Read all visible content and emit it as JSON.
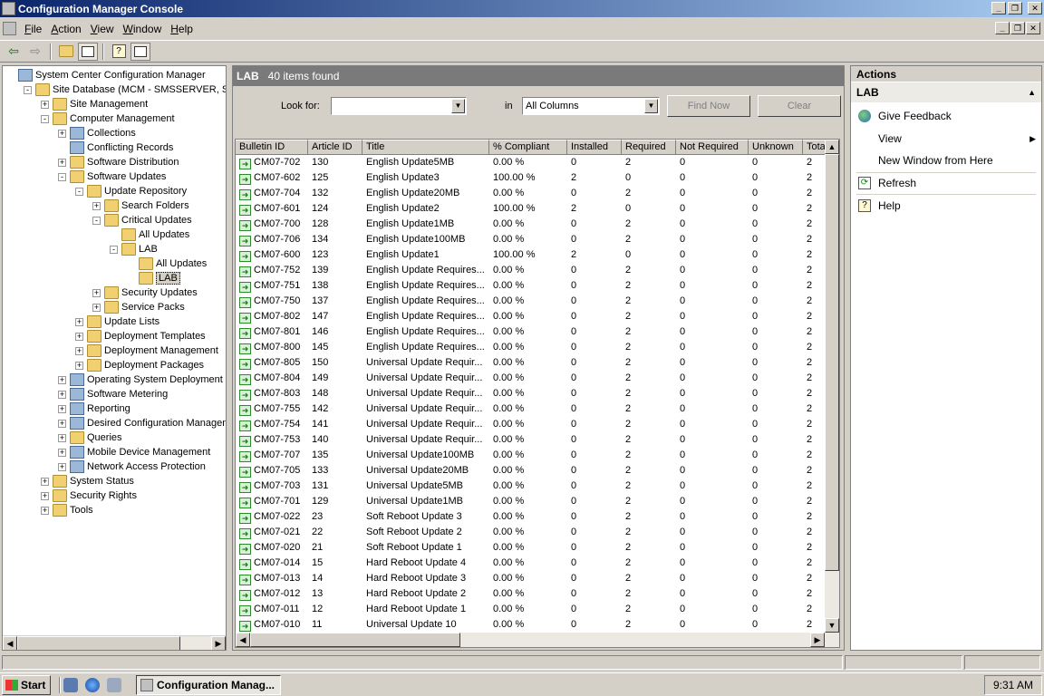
{
  "window": {
    "title": "Configuration Manager Console"
  },
  "menu": [
    "File",
    "Action",
    "View",
    "Window",
    "Help"
  ],
  "tree": [
    {
      "label": "System Center Configuration Manager",
      "level": 0,
      "exp": "none",
      "icon": "pc"
    },
    {
      "label": "Site Database  (MCM - SMSSERVER, SCCM",
      "level": 1,
      "exp": "-",
      "icon": "folder"
    },
    {
      "label": "Site Management",
      "level": 2,
      "exp": "+",
      "icon": "folder"
    },
    {
      "label": "Computer Management",
      "level": 2,
      "exp": "-",
      "icon": "folder"
    },
    {
      "label": "Collections",
      "level": 3,
      "exp": "+",
      "icon": "pc"
    },
    {
      "label": "Conflicting Records",
      "level": 3,
      "exp": "none",
      "icon": "pc"
    },
    {
      "label": "Software Distribution",
      "level": 3,
      "exp": "+",
      "icon": "folder"
    },
    {
      "label": "Software Updates",
      "level": 3,
      "exp": "-",
      "icon": "folder"
    },
    {
      "label": "Update Repository",
      "level": 4,
      "exp": "-",
      "icon": "folder"
    },
    {
      "label": "Search Folders",
      "level": 5,
      "exp": "+",
      "icon": "folder"
    },
    {
      "label": "Critical Updates",
      "level": 5,
      "exp": "-",
      "icon": "folder"
    },
    {
      "label": "All Updates",
      "level": 6,
      "exp": "none",
      "icon": "folder"
    },
    {
      "label": "LAB",
      "level": 6,
      "exp": "-",
      "icon": "folder"
    },
    {
      "label": "All Updates",
      "level": 7,
      "exp": "none",
      "icon": "folder"
    },
    {
      "label": "LAB",
      "level": 7,
      "exp": "none",
      "icon": "folder",
      "selected": true
    },
    {
      "label": "Security Updates",
      "level": 5,
      "exp": "+",
      "icon": "folder"
    },
    {
      "label": "Service Packs",
      "level": 5,
      "exp": "+",
      "icon": "folder"
    },
    {
      "label": "Update Lists",
      "level": 4,
      "exp": "+",
      "icon": "folder"
    },
    {
      "label": "Deployment Templates",
      "level": 4,
      "exp": "+",
      "icon": "folder"
    },
    {
      "label": "Deployment Management",
      "level": 4,
      "exp": "+",
      "icon": "folder"
    },
    {
      "label": "Deployment Packages",
      "level": 4,
      "exp": "+",
      "icon": "folder"
    },
    {
      "label": "Operating System Deployment",
      "level": 3,
      "exp": "+",
      "icon": "pc"
    },
    {
      "label": "Software Metering",
      "level": 3,
      "exp": "+",
      "icon": "pc"
    },
    {
      "label": "Reporting",
      "level": 3,
      "exp": "+",
      "icon": "pc"
    },
    {
      "label": "Desired Configuration Managemen",
      "level": 3,
      "exp": "+",
      "icon": "pc"
    },
    {
      "label": "Queries",
      "level": 3,
      "exp": "+",
      "icon": "folder"
    },
    {
      "label": "Mobile Device Management",
      "level": 3,
      "exp": "+",
      "icon": "pc"
    },
    {
      "label": "Network Access Protection",
      "level": 3,
      "exp": "+",
      "icon": "pc"
    },
    {
      "label": "System Status",
      "level": 2,
      "exp": "+",
      "icon": "folder"
    },
    {
      "label": "Security Rights",
      "level": 2,
      "exp": "+",
      "icon": "folder"
    },
    {
      "label": "Tools",
      "level": 2,
      "exp": "+",
      "icon": "folder"
    }
  ],
  "result": {
    "title": "LAB",
    "count": "40 items found"
  },
  "find": {
    "look_for_label": "Look for:",
    "look_for_value": "",
    "in_label": "in",
    "in_value": "All Columns",
    "find_now": "Find Now",
    "clear": "Clear"
  },
  "columns": [
    "Bulletin ID",
    "Article ID",
    "Title",
    "% Compliant",
    "Installed",
    "Required",
    "Not Required",
    "Unknown",
    "Tota"
  ],
  "rows": [
    [
      "CM07-702",
      "130",
      "English Update5MB",
      "0.00 %",
      "0",
      "2",
      "0",
      "0",
      "2"
    ],
    [
      "CM07-602",
      "125",
      "English Update3",
      "100.00 %",
      "2",
      "0",
      "0",
      "0",
      "2"
    ],
    [
      "CM07-704",
      "132",
      "English Update20MB",
      "0.00 %",
      "0",
      "2",
      "0",
      "0",
      "2"
    ],
    [
      "CM07-601",
      "124",
      "English Update2",
      "100.00 %",
      "2",
      "0",
      "0",
      "0",
      "2"
    ],
    [
      "CM07-700",
      "128",
      "English Update1MB",
      "0.00 %",
      "0",
      "2",
      "0",
      "0",
      "2"
    ],
    [
      "CM07-706",
      "134",
      "English Update100MB",
      "0.00 %",
      "0",
      "2",
      "0",
      "0",
      "2"
    ],
    [
      "CM07-600",
      "123",
      "English Update1",
      "100.00 %",
      "2",
      "0",
      "0",
      "0",
      "2"
    ],
    [
      "CM07-752",
      "139",
      "English Update Requires...",
      "0.00 %",
      "0",
      "2",
      "0",
      "0",
      "2"
    ],
    [
      "CM07-751",
      "138",
      "English Update Requires...",
      "0.00 %",
      "0",
      "2",
      "0",
      "0",
      "2"
    ],
    [
      "CM07-750",
      "137",
      "English Update Requires...",
      "0.00 %",
      "0",
      "2",
      "0",
      "0",
      "2"
    ],
    [
      "CM07-802",
      "147",
      "English Update Requires...",
      "0.00 %",
      "0",
      "2",
      "0",
      "0",
      "2"
    ],
    [
      "CM07-801",
      "146",
      "English Update Requires...",
      "0.00 %",
      "0",
      "2",
      "0",
      "0",
      "2"
    ],
    [
      "CM07-800",
      "145",
      "English Update Requires...",
      "0.00 %",
      "0",
      "2",
      "0",
      "0",
      "2"
    ],
    [
      "CM07-805",
      "150",
      "Universal Update Requir...",
      "0.00 %",
      "0",
      "2",
      "0",
      "0",
      "2"
    ],
    [
      "CM07-804",
      "149",
      "Universal Update Requir...",
      "0.00 %",
      "0",
      "2",
      "0",
      "0",
      "2"
    ],
    [
      "CM07-803",
      "148",
      "Universal Update Requir...",
      "0.00 %",
      "0",
      "2",
      "0",
      "0",
      "2"
    ],
    [
      "CM07-755",
      "142",
      "Universal Update Requir...",
      "0.00 %",
      "0",
      "2",
      "0",
      "0",
      "2"
    ],
    [
      "CM07-754",
      "141",
      "Universal Update Requir...",
      "0.00 %",
      "0",
      "2",
      "0",
      "0",
      "2"
    ],
    [
      "CM07-753",
      "140",
      "Universal Update Requir...",
      "0.00 %",
      "0",
      "2",
      "0",
      "0",
      "2"
    ],
    [
      "CM07-707",
      "135",
      "Universal Update100MB",
      "0.00 %",
      "0",
      "2",
      "0",
      "0",
      "2"
    ],
    [
      "CM07-705",
      "133",
      "Universal Update20MB",
      "0.00 %",
      "0",
      "2",
      "0",
      "0",
      "2"
    ],
    [
      "CM07-703",
      "131",
      "Universal Update5MB",
      "0.00 %",
      "0",
      "2",
      "0",
      "0",
      "2"
    ],
    [
      "CM07-701",
      "129",
      "Universal Update1MB",
      "0.00 %",
      "0",
      "2",
      "0",
      "0",
      "2"
    ],
    [
      "CM07-022",
      "23",
      "Soft Reboot Update 3",
      "0.00 %",
      "0",
      "2",
      "0",
      "0",
      "2"
    ],
    [
      "CM07-021",
      "22",
      "Soft Reboot Update 2",
      "0.00 %",
      "0",
      "2",
      "0",
      "0",
      "2"
    ],
    [
      "CM07-020",
      "21",
      "Soft Reboot Update 1",
      "0.00 %",
      "0",
      "2",
      "0",
      "0",
      "2"
    ],
    [
      "CM07-014",
      "15",
      "Hard Reboot Update 4",
      "0.00 %",
      "0",
      "2",
      "0",
      "0",
      "2"
    ],
    [
      "CM07-013",
      "14",
      "Hard Reboot Update 3",
      "0.00 %",
      "0",
      "2",
      "0",
      "0",
      "2"
    ],
    [
      "CM07-012",
      "13",
      "Hard Reboot Update 2",
      "0.00 %",
      "0",
      "2",
      "0",
      "0",
      "2"
    ],
    [
      "CM07-011",
      "12",
      "Hard Reboot Update 1",
      "0.00 %",
      "0",
      "2",
      "0",
      "0",
      "2"
    ],
    [
      "CM07-010",
      "11",
      "Universal Update 10",
      "0.00 %",
      "0",
      "2",
      "0",
      "0",
      "2"
    ]
  ],
  "actions": {
    "title": "Actions",
    "section": "LAB",
    "items": [
      {
        "label": "Give Feedback",
        "icon": "globe-icon"
      },
      {
        "label": "View",
        "icon": "",
        "submenu": true
      },
      {
        "label": "New Window from Here",
        "icon": ""
      },
      {
        "label": "Refresh",
        "icon": "refresh-icon"
      },
      {
        "label": "Help",
        "icon": "help-icon"
      }
    ]
  },
  "taskbar": {
    "start": "Start",
    "task": "Configuration Manag...",
    "clock": "9:31 AM"
  }
}
